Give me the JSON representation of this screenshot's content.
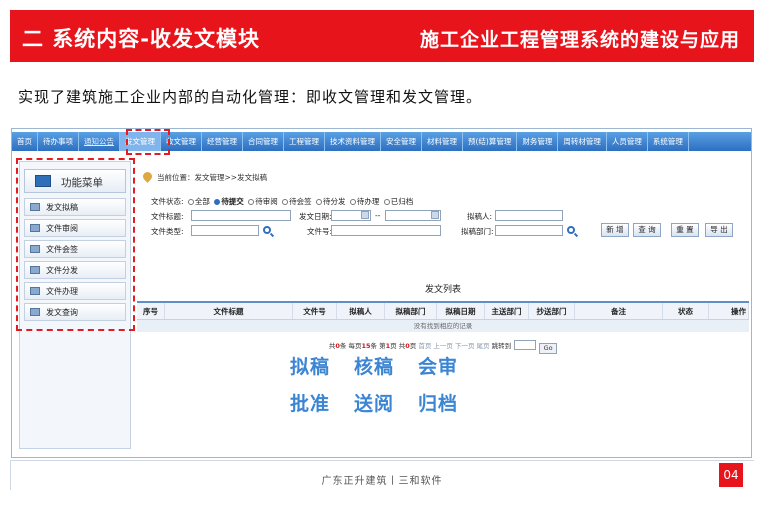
{
  "header": {
    "left_title": "二 系统内容-收发文模块",
    "right_title": "施工企业工程管理系统的建设与应用"
  },
  "intro": "实现了建筑施工企业内部的自动化管理：即收文管理和发文管理。",
  "app": {
    "menu": [
      "首页",
      "待办事项",
      "通知公告",
      "发文管理",
      "收文管理",
      "经营管理",
      "合同管理",
      "工程管理",
      "技术资料管理",
      "安全管理",
      "材料管理",
      "预(结)算管理",
      "财务管理",
      "周转材管理",
      "人员管理",
      "系统管理"
    ],
    "active_menu": "发文管理",
    "sidebar": {
      "title": "功能菜单",
      "items": [
        "发文拟稿",
        "文件审阅",
        "文件会签",
        "文件分发",
        "文件办理",
        "发文查询"
      ]
    },
    "breadcrumb": "当前位置：发文管理>>发文拟稿",
    "filter": {
      "status_label": "文件状态:",
      "statuses": [
        "全部",
        "待提交",
        "待审阅",
        "待会签",
        "待分发",
        "待办理",
        "已归档"
      ],
      "selected_status": "待提交",
      "title_label": "文件标题:",
      "date_label": "发文日期:",
      "date_sep": "--",
      "drafter_label": "拟稿人:",
      "type_label": "文件类型:",
      "number_label": "文件号:",
      "dept_label": "拟稿部门:",
      "buttons": [
        "新 增",
        "查 询",
        "重 置",
        "导 出"
      ]
    },
    "list": {
      "title": "发文列表",
      "columns": [
        "序号",
        "文件标题",
        "文件号",
        "拟稿人",
        "拟稿部门",
        "拟稿日期",
        "主送部门",
        "抄送部门",
        "备注",
        "状态",
        "操作"
      ],
      "empty_text": "没有找到相应的记录"
    },
    "pager": {
      "total_prefix": "共",
      "total": "0",
      "total_suffix": "条",
      "per_page_prefix": " 每页",
      "per_page": "15",
      "per_page_suffix": "条",
      "page_prefix": " 第",
      "page": "1",
      "page_suffix": "页",
      "pages_prefix": " 共",
      "pages": "0",
      "pages_suffix": "页",
      "nav": " 首页 上一页 下一页 尾页 ",
      "jump_label": "跳转到",
      "go_label": "Go"
    }
  },
  "steps": {
    "row1": [
      "拟稿",
      "核稿",
      "会审"
    ],
    "row2": [
      "批准",
      "送阅",
      "归档"
    ]
  },
  "footer": {
    "text": "广东正升建筑丨三和软件",
    "page_number": "04"
  },
  "colors": {
    "brand_red": "#e8141c",
    "menu_blue": "#2d6fc1",
    "step_blue": "#3b85d3"
  }
}
